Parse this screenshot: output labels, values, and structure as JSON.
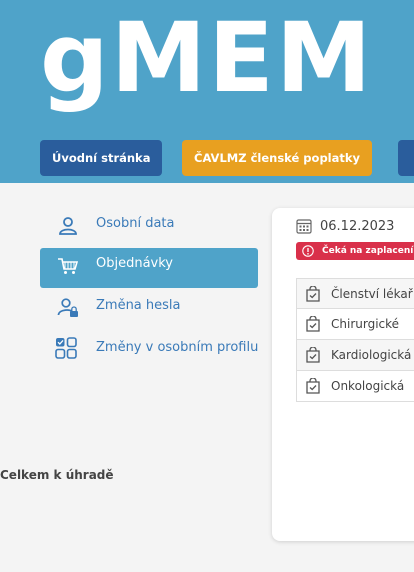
{
  "brand": {
    "logo": "gMEM"
  },
  "nav": {
    "tabs": [
      {
        "label": "Úvodní stránka",
        "color": "#2a5d9c"
      },
      {
        "label": "ČAVLMZ členské poplatky",
        "color": "#e8a020"
      },
      {
        "label": "",
        "color": "#2a5d9c"
      }
    ]
  },
  "sidebar": {
    "items": [
      {
        "label": "Osobní data",
        "icon": "user-icon",
        "active": false
      },
      {
        "label": "Objednávky",
        "icon": "cart-icon",
        "active": true
      },
      {
        "label": "Změna hesla",
        "icon": "user-lock-icon",
        "active": false
      },
      {
        "label": "Změny v osobním profilu",
        "icon": "grid-squares-icon",
        "active": false
      }
    ]
  },
  "order": {
    "date": "06.12.2023",
    "status": "Čeká na zaplacení",
    "items": [
      {
        "label": "Členství lékař"
      },
      {
        "label": "Chirurgické"
      },
      {
        "label": "Kardiologická"
      },
      {
        "label": "Onkologická"
      }
    ],
    "total_label": "Celkem k úhradě"
  },
  "colors": {
    "header": "#4fa3c9",
    "accent": "#4fa3c9",
    "badge": "#d9304a",
    "link": "#3a7ab8"
  }
}
